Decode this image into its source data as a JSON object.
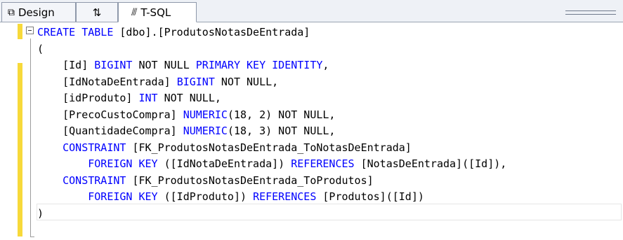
{
  "tabs": {
    "design_label": "Design",
    "swap_symbol": "⇅",
    "tsql_label": "T-SQL"
  },
  "code_lines": [
    [
      {
        "t": "CREATE",
        "c": "kw"
      },
      {
        "t": " "
      },
      {
        "t": "TABLE",
        "c": "kw"
      },
      {
        "t": " [dbo].[ProdutosNotasDeEntrada]"
      }
    ],
    [
      {
        "t": "("
      }
    ],
    [
      {
        "t": "    [Id] "
      },
      {
        "t": "BIGINT",
        "c": "kw"
      },
      {
        "t": " NOT NULL ",
        "c": "gy_no"
      },
      {
        "t": "PRIMARY",
        "c": "kw"
      },
      {
        "t": " "
      },
      {
        "t": "KEY",
        "c": "kw"
      },
      {
        "t": " "
      },
      {
        "t": "IDENTITY",
        "c": "kw"
      },
      {
        "t": ","
      }
    ],
    [
      {
        "t": "    [IdNotaDeEntrada] "
      },
      {
        "t": "BIGINT",
        "c": "kw"
      },
      {
        "t": " NOT NULL,"
      }
    ],
    [
      {
        "t": "    [idProduto] "
      },
      {
        "t": "INT",
        "c": "kw"
      },
      {
        "t": " NOT NULL,"
      }
    ],
    [
      {
        "t": "    [PrecoCustoCompra] "
      },
      {
        "t": "NUMERIC",
        "c": "kw"
      },
      {
        "t": "(18, 2) NOT NULL,"
      }
    ],
    [
      {
        "t": "    [QuantidadeCompra] "
      },
      {
        "t": "NUMERIC",
        "c": "kw"
      },
      {
        "t": "(18, 3) NOT NULL,"
      }
    ],
    [
      {
        "t": "    "
      },
      {
        "t": "CONSTRAINT",
        "c": "kw"
      },
      {
        "t": " [FK_ProdutosNotasDeEntrada_ToNotasDeEntrada]"
      }
    ],
    [
      {
        "t": "        "
      },
      {
        "t": "FOREIGN",
        "c": "kw"
      },
      {
        "t": " "
      },
      {
        "t": "KEY",
        "c": "kw"
      },
      {
        "t": " ([IdNotaDeEntrada]) "
      },
      {
        "t": "REFERENCES",
        "c": "kw"
      },
      {
        "t": " [NotasDeEntrada]([Id]),"
      }
    ],
    [
      {
        "t": "    "
      },
      {
        "t": "CONSTRAINT",
        "c": "kw"
      },
      {
        "t": " [FK_ProdutosNotasDeEntrada_ToProdutos]"
      }
    ],
    [
      {
        "t": "        "
      },
      {
        "t": "FOREIGN",
        "c": "kw"
      },
      {
        "t": " "
      },
      {
        "t": "KEY",
        "c": "kw"
      },
      {
        "t": " ([IdProduto]) "
      },
      {
        "t": "REFERENCES",
        "c": "kw"
      },
      {
        "t": " [Produtos]([Id])"
      }
    ],
    [
      {
        "t": ")"
      }
    ]
  ],
  "colors": {
    "keyword": "#0000ff",
    "plain": "#000000",
    "change_marker": "#f7d93a"
  }
}
